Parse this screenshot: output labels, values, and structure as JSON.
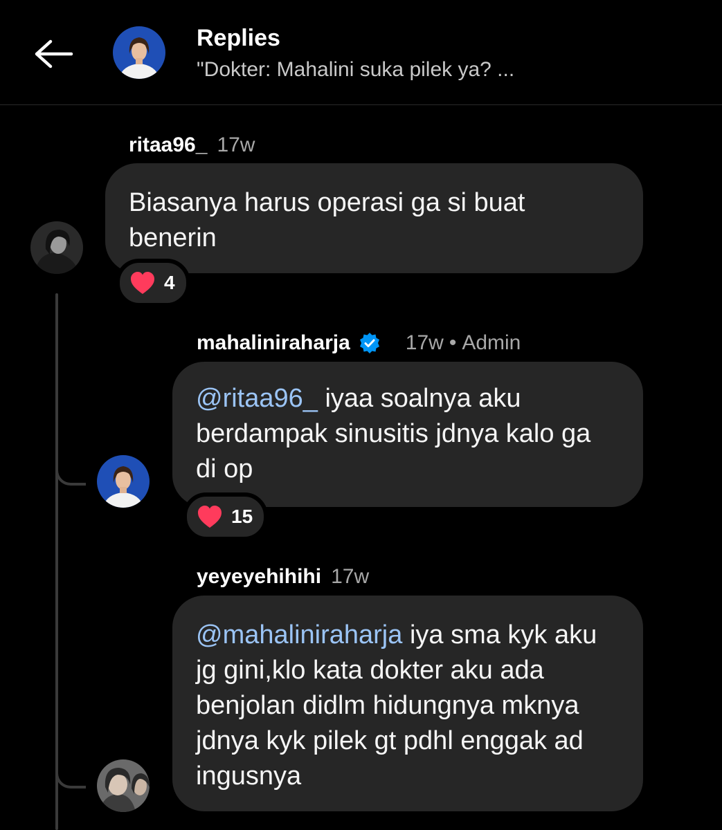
{
  "header": {
    "title": "Replies",
    "subtitle": "\"Dokter: Mahalini suka pilek ya? ..."
  },
  "comments": [
    {
      "username": "ritaa96_",
      "time": "17w",
      "text": "Biasanya harus operasi ga si buat benerin",
      "reaction_count": "4"
    },
    {
      "username": "mahaliniraharja",
      "verified": true,
      "time": "17w",
      "separator": "•",
      "role": "Admin",
      "mention": "@ritaa96_",
      "text": " iyaa soalnya aku berdampak sinusitis jdnya kalo ga di op",
      "reaction_count": "15"
    },
    {
      "username": "yeyeyehihihi",
      "time": "17w",
      "mention": "@mahaliniraharja",
      "text": " iya sma kyk aku jg gini,klo kata dokter aku ada benjolan didlm hidungnya mknya jdnya kyk pilek gt pdhl enggak ad ingusnya"
    }
  ],
  "colors": {
    "background": "#000000",
    "bubble": "#262626",
    "mention": "#9bc4f5",
    "heart": "#ff3b5c",
    "verified": "#0095f6"
  },
  "icons": [
    "back-arrow-icon",
    "heart-icon",
    "verified-badge-icon"
  ]
}
